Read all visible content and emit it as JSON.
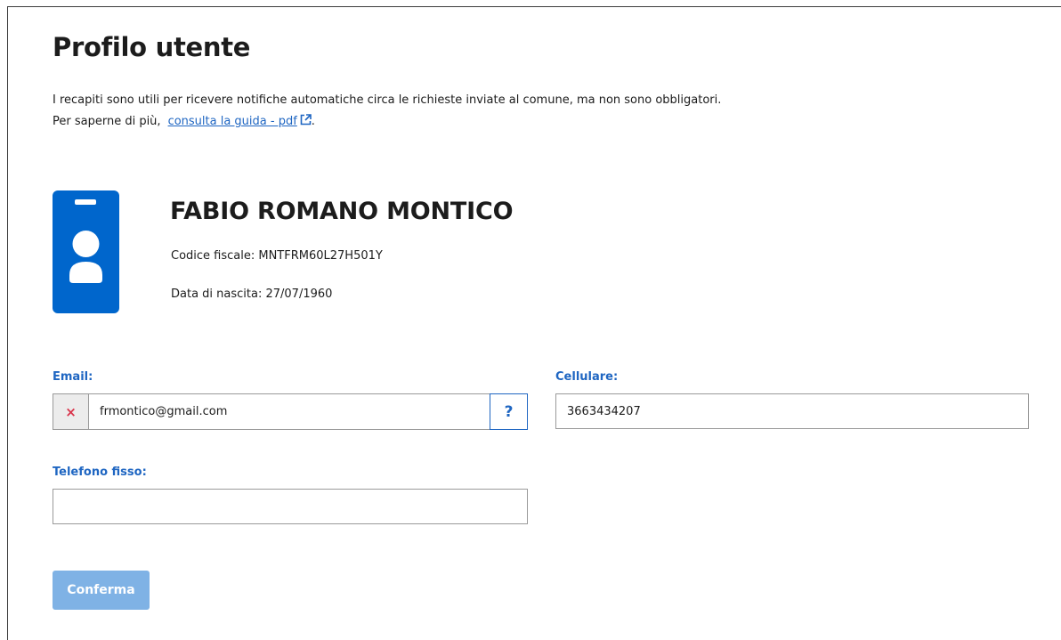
{
  "page": {
    "title": "Profilo utente",
    "intro_line1": "I recapiti sono utili per ricevere notifiche automatiche circa le richieste inviate al comune, ma non sono obbligatori.",
    "intro_line2_prefix": "Per saperne di più,",
    "guide_link_text": "consulta la guida - pdf",
    "intro_line2_suffix": "."
  },
  "user": {
    "name": "FABIO ROMANO MONTICO",
    "tax_code": "Codice fiscale: MNTFRM60L27H501Y",
    "birth_date": "Data di nascita: 27/07/1960"
  },
  "form": {
    "email_label": "Email:",
    "email_value": "frmontico@gmail.com",
    "email_status_icon": "×",
    "help_label": "?",
    "mobile_label": "Cellulare:",
    "mobile_value": "3663434207",
    "landline_label": "Telefono fisso:",
    "landline_value": "",
    "confirm_label": "Conferma"
  },
  "icons": {
    "external_link": "external-link-icon",
    "avatar": "user-badge-icon",
    "email_invalid": "close-icon",
    "help": "help-icon"
  },
  "colors": {
    "accent": "#0066cc",
    "link": "#1f66c2",
    "error": "#d9334a",
    "button_disabled": "#7fb2e5"
  }
}
